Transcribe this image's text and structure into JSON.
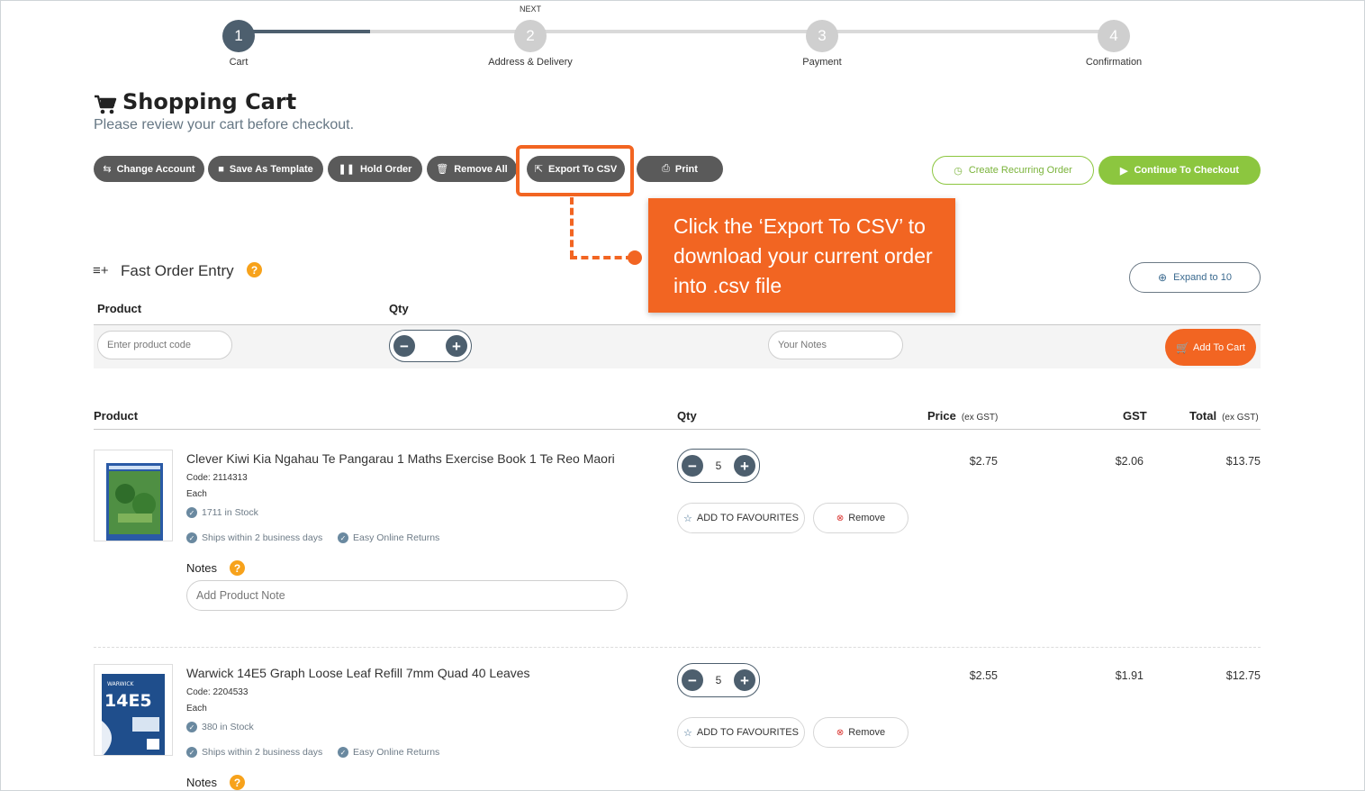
{
  "progress": {
    "next_label": "NEXT",
    "steps": [
      {
        "number": "1",
        "label": "Cart"
      },
      {
        "number": "2",
        "label": "Address & Delivery"
      },
      {
        "number": "3",
        "label": "Payment"
      },
      {
        "number": "4",
        "label": "Confirmation"
      }
    ],
    "active_step": 1
  },
  "header": {
    "title": "Shopping Cart",
    "subtitle": "Please review your cart before checkout."
  },
  "toolbar": {
    "change_account": "Change Account",
    "save_as_template": "Save As Template",
    "hold_order": "Hold Order",
    "remove_all": "Remove All",
    "export_csv": "Export To CSV",
    "print": "Print",
    "create_recurring": "Create Recurring Order",
    "continue_checkout": "Continue To Checkout"
  },
  "callout": {
    "text": "Click the ‘Export To CSV’ to download your current order into .csv file"
  },
  "fast_order": {
    "title": "Fast Order Entry",
    "help": "?",
    "expand_label": "Expand to 10",
    "col_product": "Product",
    "col_qty": "Qty",
    "product_placeholder": "Enter product code",
    "notes_placeholder": "Your Notes",
    "add_to_cart": "Add To Cart"
  },
  "cart": {
    "headers": {
      "product": "Product",
      "qty": "Qty",
      "price": "Price",
      "price_note": "(ex GST)",
      "gst": "GST",
      "total": "Total",
      "total_note": "(ex GST)"
    },
    "items": [
      {
        "name": "Clever Kiwi Kia Ngahau Te Pangarau 1 Maths Exercise Book 1 Te Reo Maori",
        "code": "Code: 2114313",
        "unit": "Each",
        "stock": "1711 in Stock",
        "ships": "Ships within 2 business days",
        "returns": "Easy Online Returns",
        "qty": "5",
        "favourite_label": "ADD TO FAVOURITES",
        "remove_label": "Remove",
        "price": "$2.75",
        "gst": "$2.06",
        "total": "$13.75",
        "notes_label": "Notes",
        "note_placeholder": "Add Product Note"
      },
      {
        "name": "Warwick 14E5 Graph Loose Leaf Refill 7mm Quad 40 Leaves",
        "code": "Code: 2204533",
        "unit": "Each",
        "stock": "380 in Stock",
        "ships": "Ships within 2 business days",
        "returns": "Easy Online Returns",
        "qty": "5",
        "favourite_label": "ADD TO FAVOURITES",
        "remove_label": "Remove",
        "price": "$2.55",
        "gst": "$1.91",
        "total": "$12.75",
        "notes_label": "Notes",
        "thumb_text": "14E5",
        "thumb_brand": "WARWICK"
      }
    ]
  },
  "colors": {
    "accent_orange": "#f26522",
    "accent_green": "#8cc63f",
    "dark_slate": "#4d5f6e",
    "button_gray": "#5a5a5a"
  }
}
